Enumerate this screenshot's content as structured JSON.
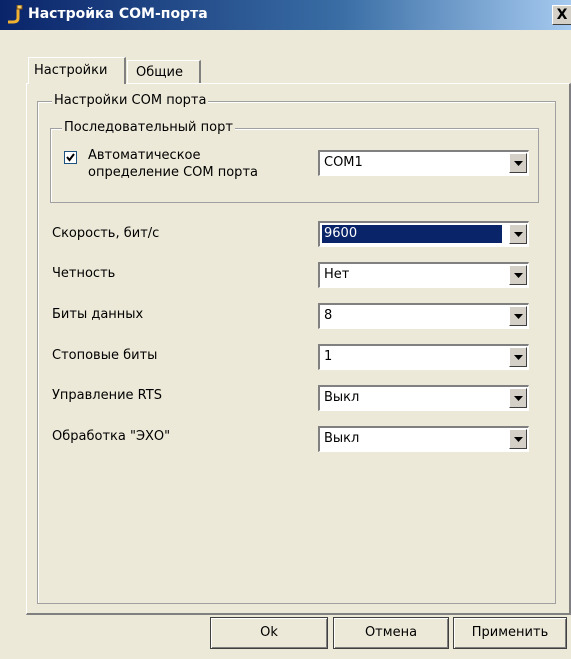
{
  "window": {
    "title": "Настройка COM-порта",
    "close_label": "X"
  },
  "tabs": [
    {
      "label": "Настройки"
    },
    {
      "label": "Общие"
    }
  ],
  "group_com": {
    "title": "Настройки COM порта"
  },
  "group_serial": {
    "title": "Последовательный порт",
    "auto_detect_line1": "Автоматическое",
    "auto_detect_line2": "определение COM порта",
    "auto_detect_checked": true,
    "port_value": "COM1"
  },
  "fields": [
    {
      "label": "Скорость, бит/с",
      "value": "9600"
    },
    {
      "label": "Четность",
      "value": "Нет"
    },
    {
      "label": "Биты данных",
      "value": "8"
    },
    {
      "label": "Стоповые биты",
      "value": "1"
    },
    {
      "label": "Управление RTS",
      "value": "Выкл"
    },
    {
      "label": "Обработка \"ЭХО\"",
      "value": "Выкл"
    }
  ],
  "buttons": {
    "ok": "Ok",
    "cancel": "Отмена",
    "apply": "Применить"
  },
  "colors": {
    "title_bar": "#0a246a",
    "face": "#ece9d8",
    "selection": "#0a246a"
  }
}
